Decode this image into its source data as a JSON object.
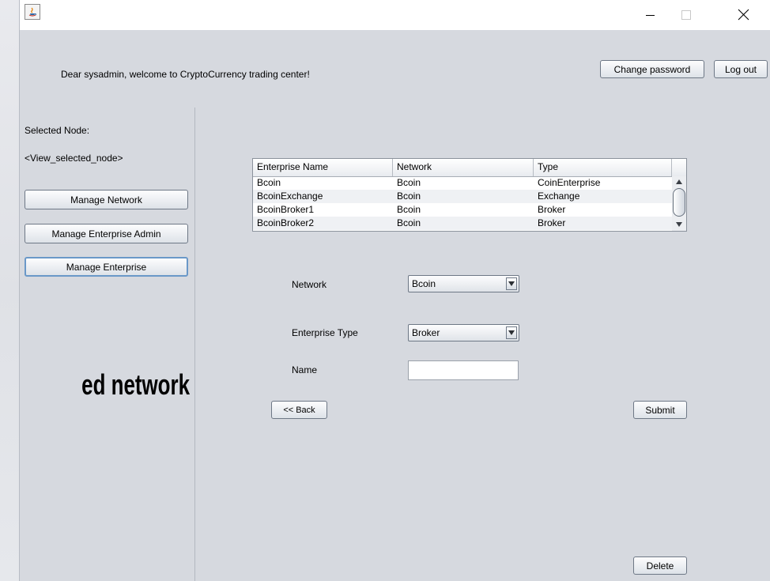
{
  "colors": {
    "window_bg": "#d6d9df",
    "titlebar_bg": "#ffffff",
    "focus_border": "#6a98c8"
  },
  "background_text": "ed network",
  "titlebar": {
    "app_icon": "java-icon",
    "controls": {
      "minimize": "minimize-icon",
      "maximize": "maximize-icon",
      "close": "close-icon"
    }
  },
  "header": {
    "welcome": "Dear sysadmin, welcome to CryptoCurrency trading center!",
    "change_password": "Change password",
    "logout": "Log out"
  },
  "sidebar": {
    "selected_node_label": "Selected Node:",
    "selected_node_value": "<View_selected_node>",
    "buttons": {
      "manage_network": "Manage Network",
      "manage_enterprise_admin": "Manage Enterprise Admin",
      "manage_enterprise": "Manage Enterprise"
    }
  },
  "table": {
    "columns": [
      "Enterprise Name",
      "Network",
      "Type"
    ],
    "rows": [
      [
        "Bcoin",
        "Bcoin",
        "CoinEnterprise"
      ],
      [
        "BcoinExchange",
        "Bcoin",
        "Exchange"
      ],
      [
        "BcoinBroker1",
        "Bcoin",
        "Broker"
      ],
      [
        "BcoinBroker2",
        "Bcoin",
        "Broker"
      ]
    ]
  },
  "form": {
    "network_label": "Network",
    "network_value": "Bcoin",
    "enterprise_type_label": "Enterprise Type",
    "enterprise_type_value": "Broker",
    "name_label": "Name",
    "name_value": ""
  },
  "buttons": {
    "back": "<< Back",
    "submit": "Submit",
    "delete": "Delete"
  }
}
